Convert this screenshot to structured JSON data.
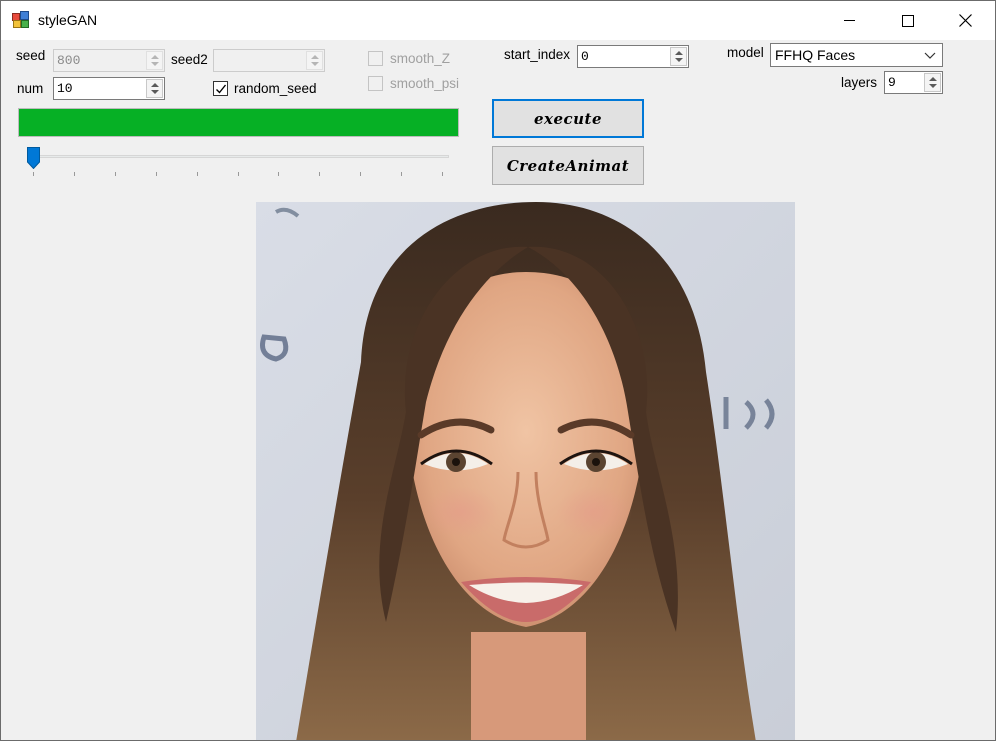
{
  "window": {
    "title": "styleGAN"
  },
  "controls": {
    "seed_label": "seed",
    "seed_value": "800",
    "seed2_label": "seed2",
    "seed2_value": "",
    "num_label": "num",
    "num_value": "10",
    "random_seed_label": "random_seed",
    "random_seed_checked": true,
    "smooth_z_label": "smooth_Z",
    "smooth_psi_label": "smooth_psi",
    "start_index_label": "start_index",
    "start_index_value": "0",
    "model_label": "model",
    "model_value": "FFHQ Faces",
    "layers_label": "layers",
    "layers_value": "9"
  },
  "progress": {
    "fraction": 1.0,
    "color": "#06b025"
  },
  "slider": {
    "value_fraction": 0.0,
    "tick_count": 11
  },
  "buttons": {
    "execute_label": "execute",
    "create_animation_label": "CreateAnimat"
  },
  "icons": {
    "app": "app-icon",
    "minimize": "minimize-icon",
    "maximize": "maximize-icon",
    "close": "close-icon",
    "dropdown": "chevron-down-icon",
    "check": "checkmark-icon"
  },
  "colors": {
    "accent": "#0078d7",
    "progress": "#06b025"
  },
  "image": {
    "description": "generated-face-image"
  }
}
